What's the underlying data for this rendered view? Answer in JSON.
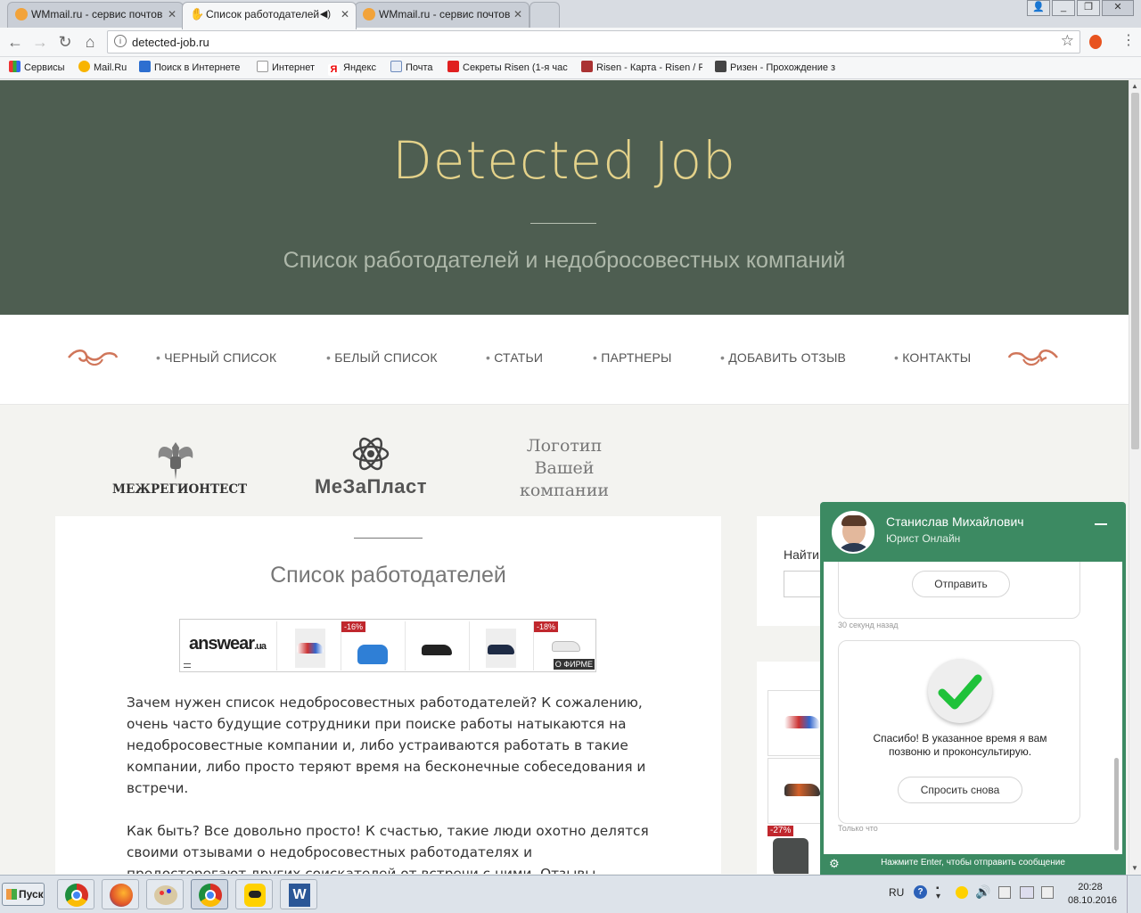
{
  "browser": {
    "tabs": [
      {
        "label": "WMmail.ru - сервис почтов",
        "active": false
      },
      {
        "label": "Список работодателей",
        "active": true
      },
      {
        "label": "WMmail.ru - сервис почтов",
        "active": false
      }
    ],
    "url": "detected-job.ru",
    "bookmarks": [
      "Сервисы",
      "Mail.Ru",
      "Поиск в Интернете",
      "Интернет",
      "Яндекс",
      "Почта",
      "Секреты Risen (1-я час",
      "Risen - Карта - Risen / F",
      "Ризен - Прохождение з"
    ]
  },
  "site": {
    "title": "Detected Job",
    "subtitle": "Список работодателей и недобросовестных компаний",
    "nav": [
      "ЧЕРНЫЙ СПИСОК",
      "БЕЛЫЙ СПИСОК",
      "СТАТЬИ",
      "ПАРТНЕРЫ",
      "ДОБАВИТЬ ОТЗЫВ",
      "КОНТАКТЫ"
    ],
    "partners": {
      "p1": "МЕЖРЕГИОНТЕСТ",
      "p2": "МеЗаПласт",
      "p3_l1": "Логотип",
      "p3_l2": "Вашей",
      "p3_l3": "компании"
    },
    "content_title": "Список работодателей",
    "ad": {
      "brand": "answear",
      "brand_suffix": ".ua",
      "discounts": [
        "-16%",
        "-18%"
      ],
      "more": "О ФИРМЕ"
    },
    "paragraph1": "Зачем нужен список недобросовестных работодателей? К сожалению, очень часто будущие сотрудники при поиске работы натыкаются на недобросовестные компании и, либо устраиваются работать в такие компании, либо просто теряют время на бесконечные собеседования и встречи.",
    "paragraph2": "Как быть? Все довольно просто! К счастью, такие люди охотно делятся своими отзывами о недобросовестных работодателях и предостерегают других соискателей от встречи с ними. Отзывы попадают в список",
    "sidebar_search": "Найти",
    "sidebar_discount": "-27%"
  },
  "chat": {
    "name": "Станислав Михайлович",
    "role": "Юрист Онлайн",
    "send": "Отправить",
    "ts1": "30 секунд назад",
    "thanks": "Спасибо! В указанное время я вам позвоню и проконсультирую.",
    "ask_again": "Спросить снова",
    "ts2": "Только что",
    "footer": "Нажмите Enter, чтобы отправить сообщение"
  },
  "taskbar": {
    "start": "Пуск",
    "lang": "RU",
    "time": "20:28",
    "date": "08.10.2016"
  }
}
